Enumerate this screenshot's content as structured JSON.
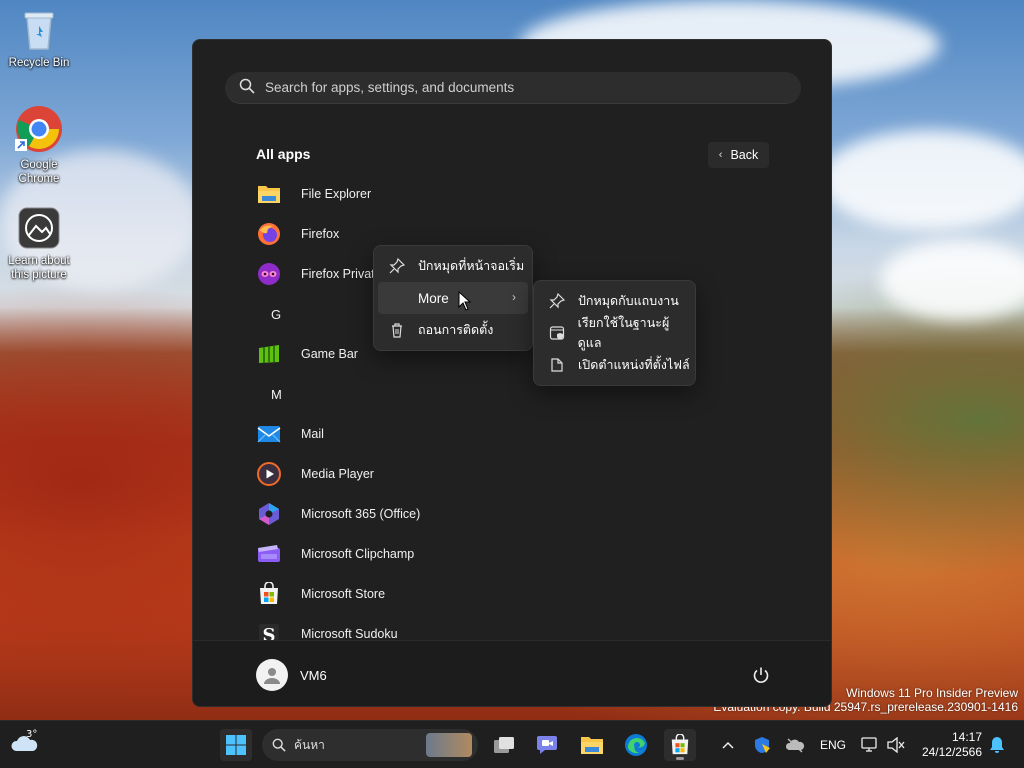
{
  "desktop": {
    "icons": [
      {
        "label": "Recycle Bin"
      },
      {
        "label": "Google Chrome"
      },
      {
        "label": "Learn about this picture"
      }
    ],
    "watermark_line1": "Windows 11 Pro Insider Preview",
    "watermark_line2": "Evaluation copy. Build 25947.rs_prerelease.230901-1416"
  },
  "start_menu": {
    "search_placeholder": "Search for apps, settings, and documents",
    "section_title": "All apps",
    "back_label": "Back",
    "apps": [
      {
        "type": "app",
        "label": "File Explorer",
        "icon": "folder-icon"
      },
      {
        "type": "app",
        "label": "Firefox",
        "icon": "firefox-icon"
      },
      {
        "type": "app",
        "label": "Firefox Private",
        "icon": "firefox-private-icon"
      },
      {
        "type": "letter",
        "label": "G"
      },
      {
        "type": "app",
        "label": "Game Bar",
        "icon": "game-bar-icon"
      },
      {
        "type": "letter",
        "label": "M"
      },
      {
        "type": "app",
        "label": "Mail",
        "icon": "mail-icon"
      },
      {
        "type": "app",
        "label": "Media Player",
        "icon": "media-player-icon"
      },
      {
        "type": "app",
        "label": "Microsoft 365 (Office)",
        "icon": "office-icon"
      },
      {
        "type": "app",
        "label": "Microsoft Clipchamp",
        "icon": "clipchamp-icon"
      },
      {
        "type": "app",
        "label": "Microsoft Store",
        "icon": "store-icon"
      },
      {
        "type": "app",
        "label": "Microsoft Sudoku",
        "icon": "sudoku-icon"
      }
    ],
    "user_name": "VM6"
  },
  "context_menu": {
    "items": [
      {
        "label": "ปักหมุดที่หน้าจอเริ่ม",
        "icon": "pin-icon"
      },
      {
        "label": "More",
        "icon": "",
        "has_submenu": true
      },
      {
        "label": "ถอนการติดตั้ง",
        "icon": "trash-icon"
      }
    ]
  },
  "submenu": {
    "items": [
      {
        "label": "ปักหมุดกับแถบงาน",
        "icon": "pin-icon"
      },
      {
        "label": "เรียกใช้ในฐานะผู้ดูแล",
        "icon": "admin-shield-icon"
      },
      {
        "label": "เปิดตำแหน่งที่ตั้งไฟล์",
        "icon": "file-location-icon"
      }
    ]
  },
  "taskbar": {
    "weather_temp": "3°",
    "search_placeholder": "ค้นหา",
    "language": "ENG",
    "time": "14:17",
    "date": "24/12/2566"
  }
}
